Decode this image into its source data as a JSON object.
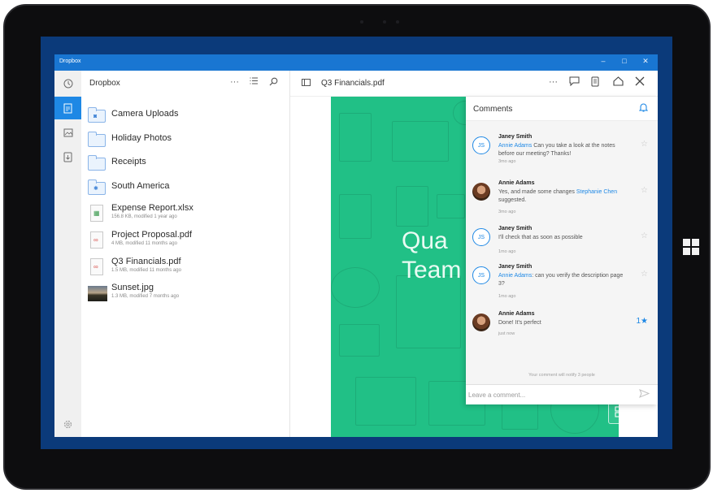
{
  "window": {
    "title": "Dropbox",
    "controls": {
      "minimize": "–",
      "maximize": "□",
      "close": "✕"
    }
  },
  "rail": {
    "items": [
      {
        "icon": "clock-icon"
      },
      {
        "icon": "document-icon",
        "active": true
      },
      {
        "icon": "image-icon"
      },
      {
        "icon": "offline-icon"
      }
    ],
    "settings_icon": "gear-icon"
  },
  "files": {
    "title": "Dropbox",
    "items": [
      {
        "name": "Camera Uploads",
        "type": "folder",
        "icon": "camera-folder-icon"
      },
      {
        "name": "Holiday Photos",
        "type": "folder",
        "icon": "folder-icon"
      },
      {
        "name": "Receipts",
        "type": "folder",
        "icon": "folder-icon"
      },
      {
        "name": "South America",
        "type": "folder",
        "icon": "shared-folder-icon"
      },
      {
        "name": "Expense Report.xlsx",
        "meta": "156.8 KB, modified 1 year ago",
        "type": "spreadsheet",
        "icon": "spreadsheet-icon"
      },
      {
        "name": "Project Proposal.pdf",
        "meta": "4 MB, modified 11 months ago",
        "type": "pdf",
        "icon": "pdf-icon"
      },
      {
        "name": "Q3 Financials.pdf",
        "meta": "1.5 MB, modified 11 months ago",
        "type": "pdf",
        "icon": "pdf-icon"
      },
      {
        "name": "Sunset.jpg",
        "meta": "1.3 MB, modified 7 months ago",
        "type": "image",
        "icon": "photo-thumbnail"
      }
    ]
  },
  "viewer": {
    "file_title": "Q3 Financials.pdf",
    "page_text_line1": "Qua",
    "page_text_line2": "Team"
  },
  "comments": {
    "title": "Comments",
    "items": [
      {
        "author": "Janey Smith",
        "initials": "JS",
        "mention": "Annie Adams",
        "text": " Can you take a look at the notes before our meeting? Thanks!",
        "time": "3mo ago",
        "starred": false,
        "star_count": ""
      },
      {
        "author": "Annie Adams",
        "initials": "",
        "pre": "Yes, and made some changes ",
        "mention": "Stephanie Chen",
        "post": " suggested.",
        "time": "3mo ago",
        "starred": false,
        "star_count": ""
      },
      {
        "author": "Janey Smith",
        "initials": "JS",
        "text": "I'll check that as soon as possible",
        "time": "1mo ago",
        "starred": false,
        "star_count": ""
      },
      {
        "author": "Janey Smith",
        "initials": "JS",
        "mention": "Annie Adams",
        "text": ": can you verify the description page 3?",
        "time": "1mo ago",
        "starred": false,
        "star_count": ""
      },
      {
        "author": "Annie Adams",
        "initials": "",
        "text": "Done! It's perfect",
        "time": "just now",
        "starred": true,
        "star_count": "1"
      }
    ],
    "notify_text": "Your comment will notify 3 people",
    "input_placeholder": "Leave a comment..."
  },
  "colors": {
    "accent": "#1e88e5",
    "titlebar": "#1976d2",
    "page_green": "#21c086"
  }
}
